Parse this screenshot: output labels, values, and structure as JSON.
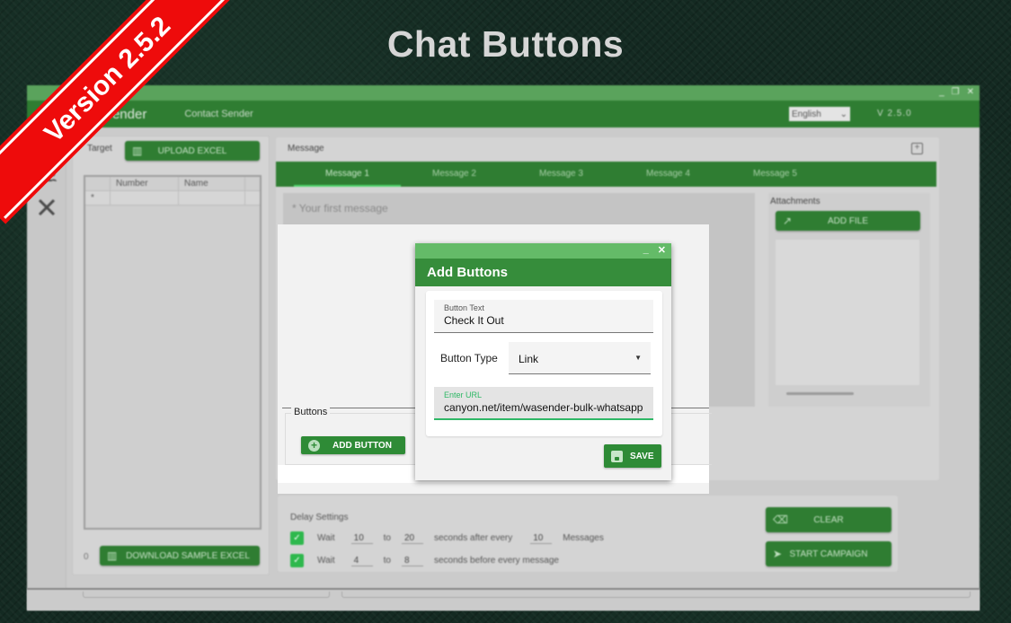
{
  "headline": "Chat Buttons",
  "ribbon": {
    "text": "Version 2.5.2",
    "color": "#ee0b0b"
  },
  "app": {
    "title": "WA Sender",
    "nav_item": "Contact Sender",
    "language": "English",
    "version": "V 2.5.0",
    "window_controls": {
      "minimize": "_",
      "restore": "❐",
      "close": "✕"
    },
    "accent_color": "#2f7d32"
  },
  "sidebar": {
    "items": [
      {
        "name": "contact-sender",
        "icon": "chat-icon",
        "active": true
      },
      {
        "name": "groups",
        "icon": "group-icon",
        "glyph": "👥"
      },
      {
        "name": "tools",
        "icon": "tools-icon",
        "glyph": "✕"
      }
    ]
  },
  "target": {
    "label": "Target",
    "upload_button": "UPLOAD EXCEL",
    "grid_columns": [
      "Number",
      "Name"
    ],
    "new_row_marker": "*",
    "count": "0",
    "download_button": "DOWNLOAD SAMPLE EXCEL"
  },
  "message": {
    "label": "Message",
    "add_tab_icon": "+",
    "tabs": [
      "Message 1",
      "Message 2",
      "Message 3",
      "Message 4",
      "Message 5"
    ],
    "active_tab": 0,
    "placeholder": "* Your first message",
    "attachments_label": "Attachments",
    "add_file_button": "ADD FILE",
    "buttons_label": "Buttons",
    "add_button_label": "ADD BUTTON"
  },
  "dialog": {
    "title": "Add Buttons",
    "controls": {
      "minimize": "_",
      "close": "✕"
    },
    "button_text_label": "Button Text",
    "button_text_value": "Check It Out",
    "button_type_label": "Button Type",
    "button_type_value": "Link",
    "url_label": "Enter URL",
    "url_value": "canyon.net/item/wasender-bulk-whatsapp",
    "save_label": "SAVE"
  },
  "delay": {
    "title": "Delay Settings",
    "rows": [
      {
        "checked": true,
        "wait": "Wait",
        "from": "10",
        "to_label": "to",
        "to": "20",
        "suffix": "seconds after every",
        "count": "10",
        "count_suffix": "Messages"
      },
      {
        "checked": true,
        "wait": "Wait",
        "from": "4",
        "to_label": "to",
        "to": "8",
        "suffix": "seconds before every message"
      }
    ],
    "clear_button": "CLEAR",
    "start_button": "START CAMPAIGN"
  }
}
